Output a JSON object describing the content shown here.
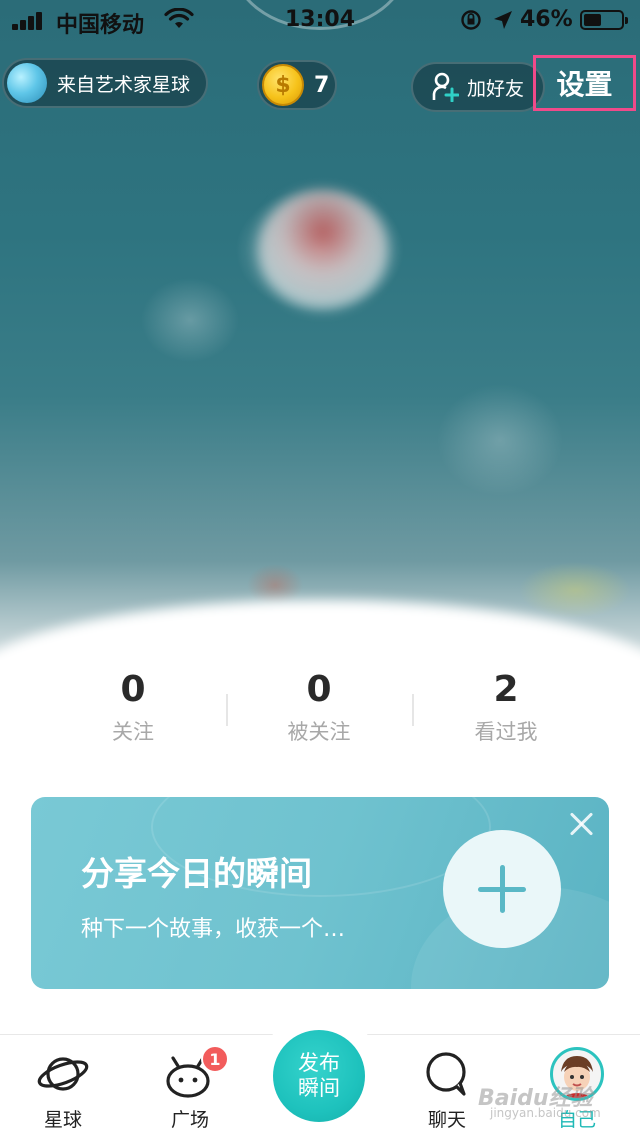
{
  "status_bar": {
    "carrier": "中国移动",
    "time": "13:04",
    "battery_percent": "46%",
    "battery_level": 0.46
  },
  "header": {
    "planet_label": "来自艺术家星球",
    "coin_count": "7",
    "coin_symbol": "$",
    "add_friend_label": "加好友",
    "settings_label": "设置",
    "highlight_color": "#f04a8a"
  },
  "stats": [
    {
      "value": "0",
      "label": "关注"
    },
    {
      "value": "0",
      "label": "被关注"
    },
    {
      "value": "2",
      "label": "看过我"
    }
  ],
  "share_card": {
    "title": "分享今日的瞬间",
    "subtitle": "种下一个故事，收获一个…",
    "close_icon": "close-icon",
    "add_icon": "plus-icon"
  },
  "tabbar": {
    "tabs": [
      {
        "label": "星球",
        "icon": "planet-icon"
      },
      {
        "label": "广场",
        "icon": "square-icon",
        "badge": "1"
      },
      {
        "label": "聊天",
        "icon": "chat-icon"
      },
      {
        "label": "自己",
        "icon": "avatar",
        "active": true
      }
    ],
    "publish_line1": "发布",
    "publish_line2": "瞬间",
    "accent_color": "#1fb9b6"
  },
  "watermark": {
    "text": "Baidu经验",
    "sub": "jingyan.baidu.com"
  }
}
